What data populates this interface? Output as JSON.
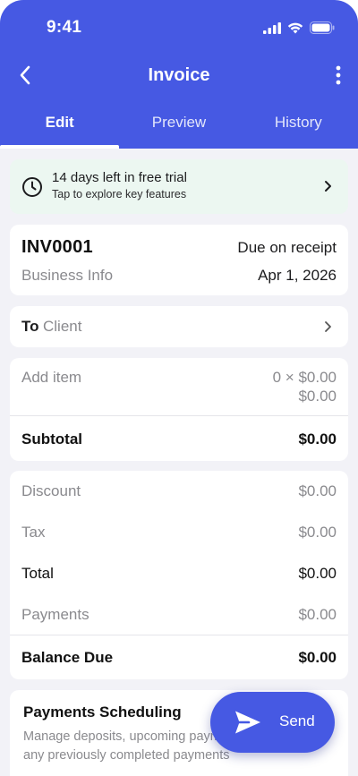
{
  "status_bar": {
    "time": "9:41"
  },
  "nav": {
    "title": "Invoice"
  },
  "tabs": [
    {
      "label": "Edit",
      "active": true
    },
    {
      "label": "Preview",
      "active": false
    },
    {
      "label": "History",
      "active": false
    }
  ],
  "trial_banner": {
    "title": "14 days left in free trial",
    "subtitle": "Tap to explore key features"
  },
  "invoice": {
    "number": "INV0001",
    "due": "Due on receipt",
    "business_info": "Business Info",
    "date": "Apr 1, 2026"
  },
  "recipient": {
    "to_label": "To",
    "client_placeholder": "Client"
  },
  "items": {
    "add_item_label": "Add item",
    "quantity_price": "0 × $0.00",
    "amount": "$0.00",
    "subtotal_label": "Subtotal",
    "subtotal_value": "$0.00"
  },
  "totals": {
    "discount_label": "Discount",
    "discount_value": "$0.00",
    "tax_label": "Tax",
    "tax_value": "$0.00",
    "total_label": "Total",
    "total_value": "$0.00",
    "payments_label": "Payments",
    "payments_value": "$0.00",
    "balance_label": "Balance Due",
    "balance_value": "$0.00"
  },
  "scheduling": {
    "title": "Payments Scheduling",
    "description": "Manage deposits, upcoming payments and record any previously completed payments"
  },
  "send_button": {
    "label": "Send"
  },
  "colors": {
    "accent": "#4659e3",
    "trial_bg": "#ecf7f1",
    "background": "#f2f2f7"
  }
}
